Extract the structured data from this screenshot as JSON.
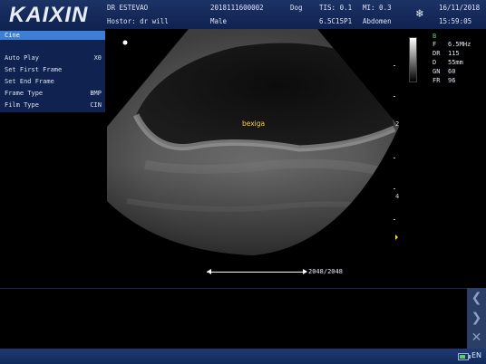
{
  "header": {
    "logo": "KAIXIN",
    "doctor": "DR ESTEVAO",
    "hostor": "Hostor: dr will",
    "patient_id": "2018111600002",
    "species": "Dog",
    "sex": "Male",
    "tis": "TIS: 0.1",
    "mi": "MI: 0.3",
    "probe": "6.5C15P1",
    "exam": "Abdomen",
    "date": "16/11/2018",
    "time": "15:59:05",
    "freeze_icon": "snowflake-icon"
  },
  "menu": {
    "title": "Cine",
    "items": [
      {
        "label": "Auto Play",
        "value": "X0"
      },
      {
        "label": "Set First Frame",
        "value": ""
      },
      {
        "label": "Set End Frame",
        "value": ""
      },
      {
        "label": "Frame Type",
        "value": "BMP"
      },
      {
        "label": "Film Type",
        "value": "CIN"
      }
    ]
  },
  "params": {
    "mode": "B",
    "rows": [
      {
        "k": "F",
        "v": "6.5MHz"
      },
      {
        "k": "DR",
        "v": "115"
      },
      {
        "k": "D",
        "v": "55mm"
      },
      {
        "k": "GN",
        "v": "60"
      },
      {
        "k": "FR",
        "v": "96"
      }
    ]
  },
  "depth_scale": [
    "2",
    "4"
  ],
  "annotation": "bexiga",
  "cine": {
    "frames": "2048/2048",
    "progress": 1.0
  },
  "nav_buttons": {
    "prev": "chevron-left-icon",
    "next": "chevron-right-icon",
    "close": "close-icon"
  },
  "status": {
    "battery_icon": "battery-icon",
    "battery_level": 0.8,
    "language": "EN"
  }
}
